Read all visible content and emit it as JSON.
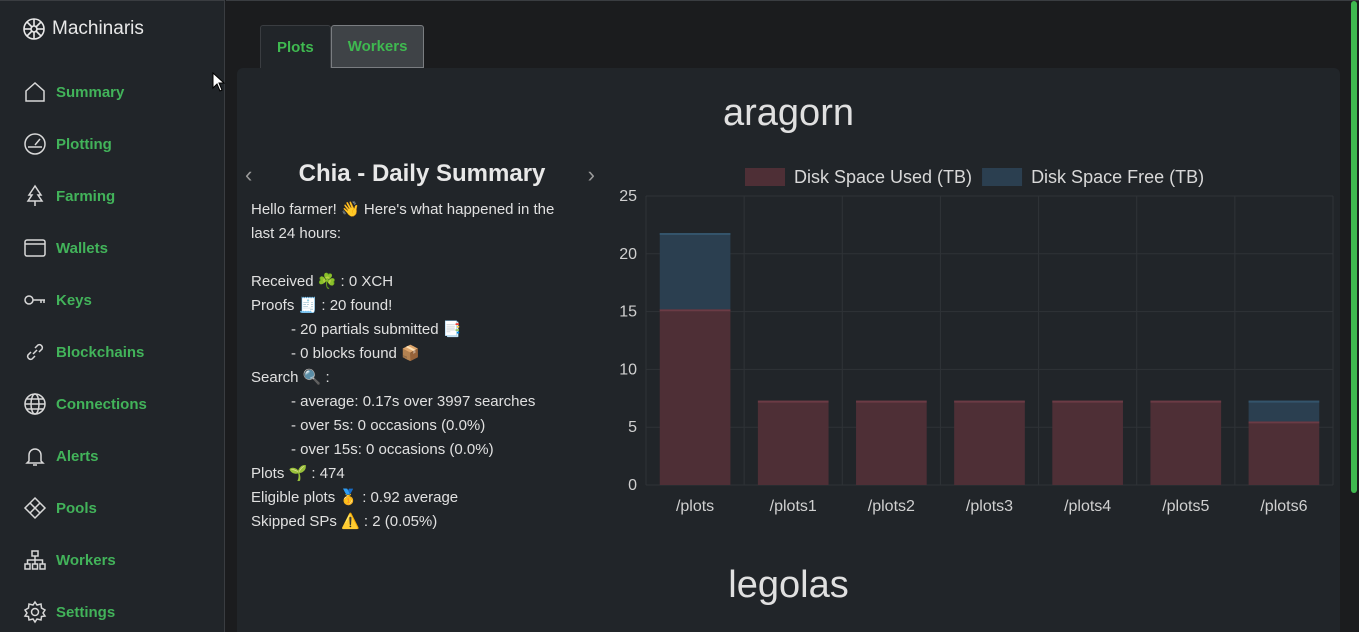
{
  "app": {
    "title": "Machinaris"
  },
  "sidebar": {
    "items": [
      {
        "label": "Summary",
        "icon": "house-icon"
      },
      {
        "label": "Plotting",
        "icon": "speedometer-icon"
      },
      {
        "label": "Farming",
        "icon": "tree-icon"
      },
      {
        "label": "Wallets",
        "icon": "wallet-icon"
      },
      {
        "label": "Keys",
        "icon": "key-icon"
      },
      {
        "label": "Blockchains",
        "icon": "link-icon"
      },
      {
        "label": "Connections",
        "icon": "globe-icon"
      },
      {
        "label": "Alerts",
        "icon": "bell-icon"
      },
      {
        "label": "Pools",
        "icon": "diamond-icon"
      },
      {
        "label": "Workers",
        "icon": "diagram-icon"
      },
      {
        "label": "Settings",
        "icon": "gear-icon"
      }
    ]
  },
  "tabs": [
    {
      "label": "Plots",
      "active": false
    },
    {
      "label": "Workers",
      "active": true
    }
  ],
  "workers": [
    {
      "name": "aragorn"
    },
    {
      "name": "legolas"
    }
  ],
  "summary": {
    "title": "Chia - Daily Summary",
    "prev_arrow": "‹",
    "next_arrow": "›",
    "greeting_1": "Hello farmer! 👋 Here's what happened in the",
    "greeting_2": "last 24 hours:",
    "received": "Received ☘️ : 0 XCH",
    "proofs": "Proofs 🧾 : 20 found!",
    "partials": "- 20 partials submitted 📑",
    "blocks": "- 0 blocks found 📦",
    "search": "Search 🔍 :",
    "average": "- average: 0.17s over 3997 searches",
    "over5": "- over 5s: 0 occasions (0.0%)",
    "over15": "- over 15s: 0 occasions (0.0%)",
    "plots": "Plots 🌱 : 474",
    "eligible": "Eligible plots 🥇 : 0.92 average",
    "skipped": "Skipped SPs ⚠️ : 2 (0.05%)"
  },
  "chart_data": {
    "type": "bar",
    "stacked": true,
    "categories": [
      "/plots",
      "/plots1",
      "/plots2",
      "/plots3",
      "/plots4",
      "/plots5",
      "/plots6"
    ],
    "series": [
      {
        "name": "Disk Space Used (TB)",
        "color": "#4e2f36",
        "values": [
          15.2,
          7.3,
          7.3,
          7.3,
          7.3,
          7.3,
          5.5
        ]
      },
      {
        "name": "Disk Space Free (TB)",
        "color": "#2b3f50",
        "values": [
          6.6,
          0,
          0,
          0,
          0,
          0,
          1.8
        ]
      }
    ],
    "ylim": [
      0,
      25
    ],
    "yticks": [
      0,
      5,
      10,
      15,
      20,
      25
    ],
    "legend": "top",
    "grid": true
  },
  "colors": {
    "accent": "#42b35a",
    "background": "#212529"
  }
}
